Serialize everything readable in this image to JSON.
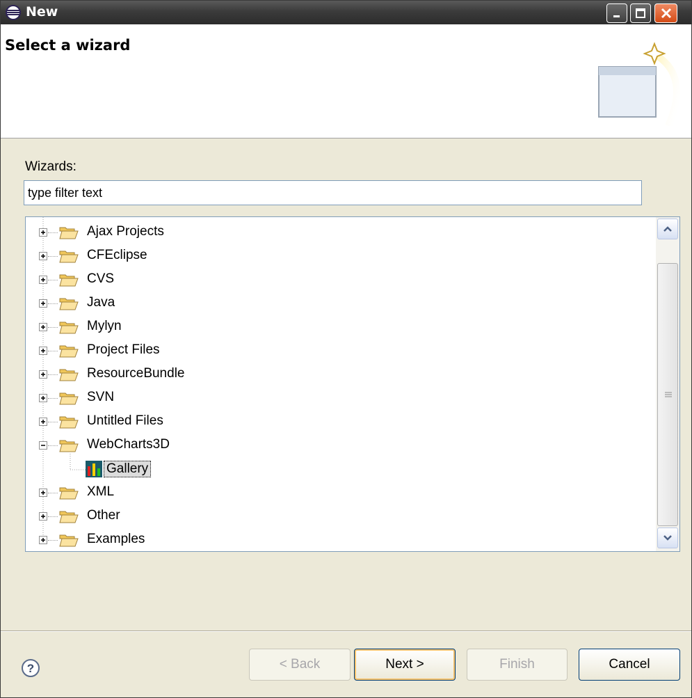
{
  "window": {
    "title": "New"
  },
  "banner": {
    "title": "Select a wizard"
  },
  "filter": {
    "label": "Wizards:",
    "value": "type filter text"
  },
  "tree": {
    "items": [
      {
        "label": "Ajax Projects",
        "expanded": false
      },
      {
        "label": "CFEclipse",
        "expanded": false
      },
      {
        "label": "CVS",
        "expanded": false
      },
      {
        "label": "Java",
        "expanded": false
      },
      {
        "label": "Mylyn",
        "expanded": false
      },
      {
        "label": "Project Files",
        "expanded": false
      },
      {
        "label": "ResourceBundle",
        "expanded": false
      },
      {
        "label": "SVN",
        "expanded": false
      },
      {
        "label": "Untitled Files",
        "expanded": false
      },
      {
        "label": "WebCharts3D",
        "expanded": true
      },
      {
        "label": "Gallery",
        "selected": true,
        "child": true
      },
      {
        "label": "XML",
        "expanded": false
      },
      {
        "label": "Other",
        "expanded": false
      },
      {
        "label": "Examples",
        "expanded": false
      }
    ]
  },
  "buttons": {
    "back": "< Back",
    "next": "Next >",
    "finish": "Finish",
    "cancel": "Cancel"
  },
  "colors": {
    "folder": "#f1c75a",
    "accent": "#316ac5",
    "close": "#d44b16"
  }
}
